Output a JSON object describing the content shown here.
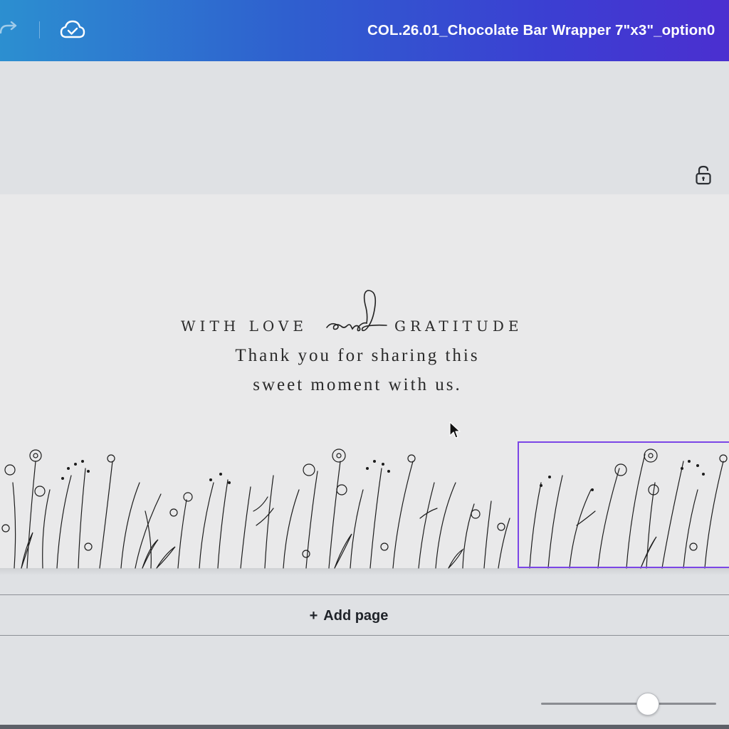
{
  "topbar": {
    "redo_icon": "redo-icon",
    "cloud_icon": "cloud-saved-icon",
    "document_title": "COL.26.01_Chocolate Bar Wrapper 7\"x3\"_option0"
  },
  "canvas": {
    "lock_icon": "unlock-icon",
    "heading_left": "WITH LOVE",
    "heading_script": "and",
    "heading_right": "GRATITUDE",
    "message_line1": "Thank you for sharing this",
    "message_line2": "sweet moment with us.",
    "illustration": "wildflowers-line-art"
  },
  "footer": {
    "add_page_plus": "+",
    "add_page_label": "Add page",
    "zoom_level": 0.6
  },
  "colors": {
    "topbar_gradient_start": "#2c8fd0",
    "topbar_gradient_end": "#4b2fd0",
    "selection": "#7b46e6",
    "page_bg": "#e9e9ea",
    "workspace_bg": "#dfe1e4"
  }
}
